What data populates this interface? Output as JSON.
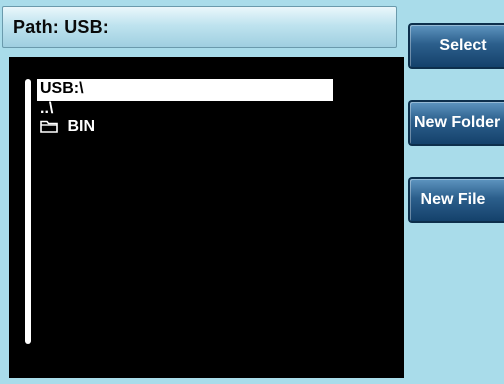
{
  "path_bar": {
    "label": "Path: USB:"
  },
  "file_list": {
    "items": [
      {
        "label": "USB:\\",
        "selected": true,
        "type": "drive"
      },
      {
        "label": "..\\",
        "selected": false,
        "type": "parent"
      },
      {
        "label": "BIN",
        "selected": false,
        "type": "folder",
        "icon": "folder-icon"
      }
    ]
  },
  "softkeys": {
    "select_label": "Select",
    "new_folder_label": "New Folder",
    "new_file_label": "New File"
  },
  "colors": {
    "screen_background": "#a9dcea",
    "panel_background": "#000000",
    "button_blue": "#2c5f8c",
    "selection": "#ffffff"
  }
}
